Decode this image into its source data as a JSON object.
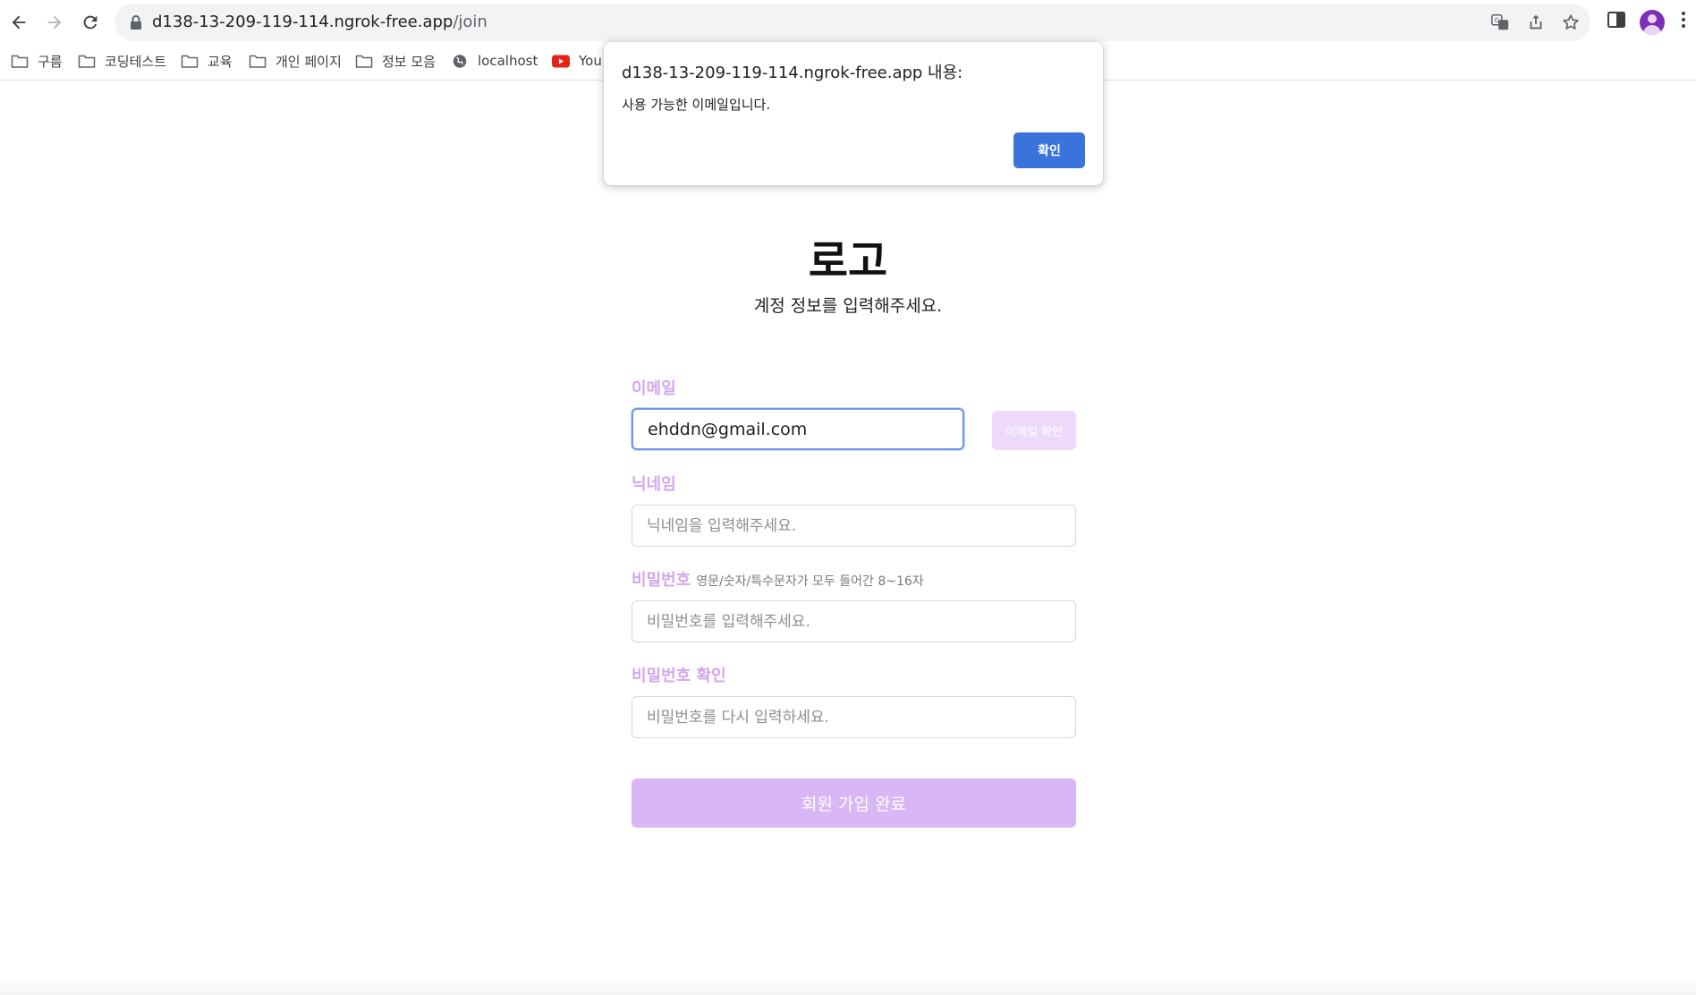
{
  "browser": {
    "url_host": "d138-13-209-119-114.ngrok-free.app",
    "url_path": "/join",
    "icons": [
      "back-icon",
      "forward-icon",
      "reload-icon",
      "lock-icon",
      "translate-icon",
      "share-icon",
      "star-icon",
      "side-panel-icon",
      "avatar",
      "menu-icon"
    ]
  },
  "bookmarks": [
    {
      "label": "구름",
      "icon": "folder-icon"
    },
    {
      "label": "코딩테스트",
      "icon": "folder-icon"
    },
    {
      "label": "교육",
      "icon": "folder-icon"
    },
    {
      "label": "개인 페이지",
      "icon": "folder-icon"
    },
    {
      "label": "정보 모음",
      "icon": "folder-icon"
    },
    {
      "label": "localhost",
      "icon": "globe-icon"
    },
    {
      "label": "You",
      "icon": "youtube-icon"
    }
  ],
  "page": {
    "logo": "로고",
    "subtitle": "계정 정보를 입력해주세요."
  },
  "form": {
    "email": {
      "label": "이메일",
      "value": "ehddn@gmail.com",
      "check_button": "이메일 확인"
    },
    "nickname": {
      "label": "닉네임",
      "placeholder": "닉네임을 입력해주세요."
    },
    "password": {
      "label": "비밀번호",
      "hint": "영문/숫자/특수문자가 모두 들어간 8~16자",
      "placeholder": "비밀번호를 입력해주세요."
    },
    "password_confirm": {
      "label": "비밀번호 확인",
      "placeholder": "비밀번호를 다시 입력하세요."
    },
    "submit": "회원 가입 완료"
  },
  "dialog": {
    "title": "d138-13-209-119-114.ngrok-free.app 내용:",
    "message": "사용 가능한 이메일입니다.",
    "ok": "확인"
  },
  "colors": {
    "accent_label": "#d3a6ef",
    "submit_bg": "#d9b7f7",
    "check_btn_bg": "#efd9fb",
    "dialog_ok_bg": "#3b73dd",
    "focus_border": "#6f96ea"
  }
}
